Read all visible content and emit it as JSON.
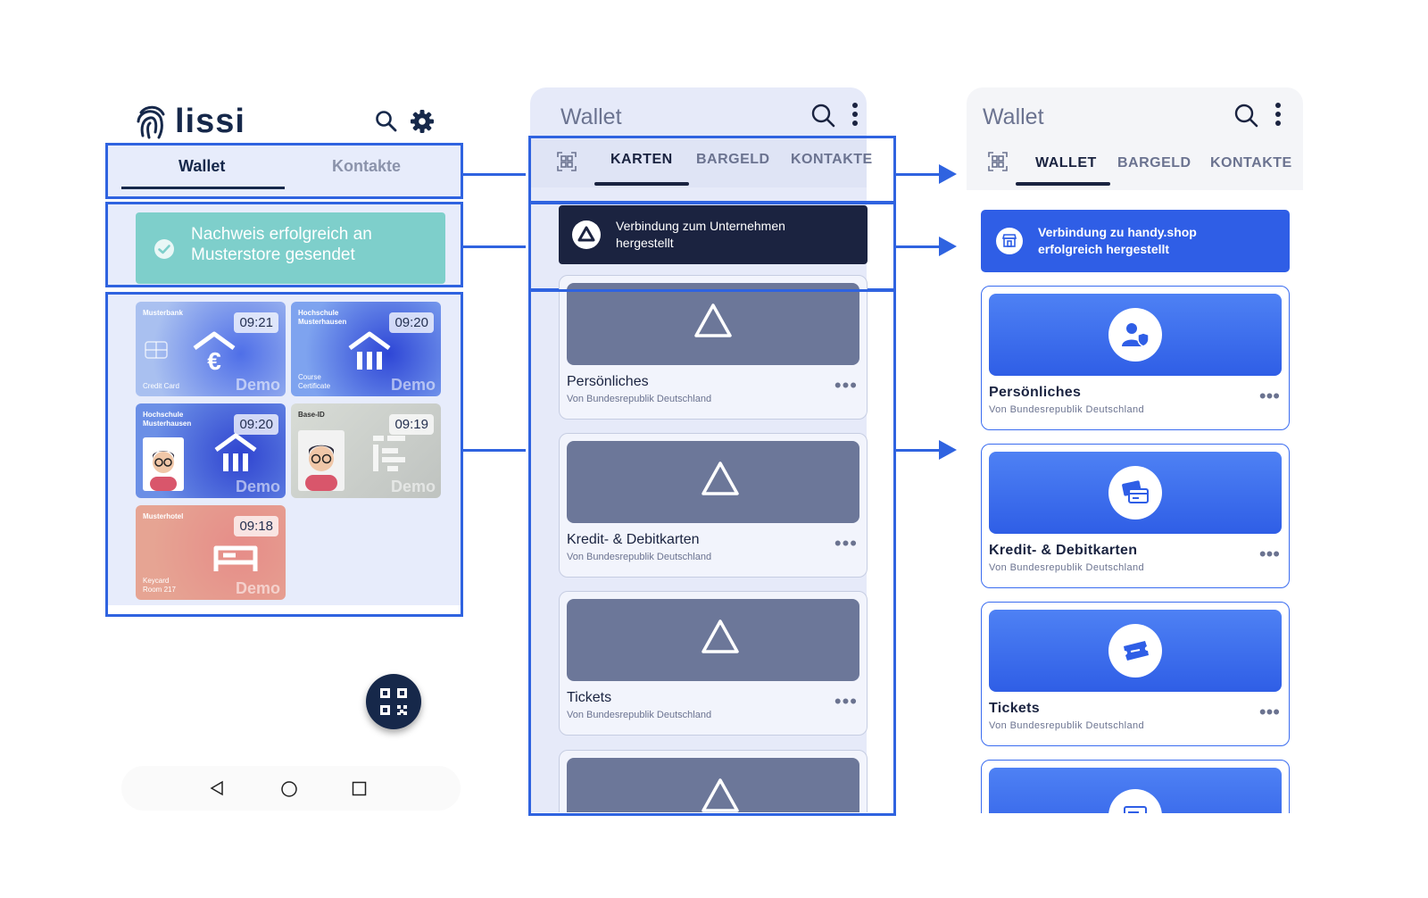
{
  "left": {
    "logo_text": "lissi",
    "tabs": [
      {
        "label": "Wallet"
      },
      {
        "label": "Kontakte"
      }
    ],
    "toast": "Nachweis erfolgreich an Musterstore gesendet",
    "toast_line1": "Nachweis erfolgreich an",
    "toast_line2": "Musterstore gesendet",
    "cards": [
      {
        "issuer": "Musterbank",
        "issuer2": "",
        "time": "09:21",
        "sub1": "Credit Card",
        "sub2": "",
        "demo": "Demo",
        "color": "#8fb0ea"
      },
      {
        "issuer": "Hochschule",
        "issuer2": "Musterhausen",
        "time": "09:20",
        "sub1": "Course",
        "sub2": "Certificate",
        "demo": "Demo",
        "color": "#6f93e8"
      },
      {
        "issuer": "Hochschule",
        "issuer2": "Musterhausen",
        "time": "09:20",
        "sub1": "",
        "sub2": "",
        "demo": "Demo",
        "color": "#5f82e0"
      },
      {
        "issuer": "Base-ID",
        "issuer2": "",
        "time": "09:19",
        "sub1": "",
        "sub2": "",
        "demo": "Demo",
        "color": "#c9cdc9"
      },
      {
        "issuer": "Musterhotel",
        "issuer2": "",
        "time": "09:18",
        "sub1": "Keycard",
        "sub2": "Room 217",
        "demo": "Demo",
        "color": "#e29a8f"
      }
    ]
  },
  "middle": {
    "title": "Wallet",
    "tabs": [
      {
        "label": "KARTEN"
      },
      {
        "label": "BARGELD"
      },
      {
        "label": "KONTAKTE"
      }
    ],
    "banner_line1": "Verbindung zum Unternehmen",
    "banner_line2": "hergestellt",
    "cards": [
      {
        "title": "Persönliches",
        "subtitle": "Von Bundesrepublik Deutschland"
      },
      {
        "title": "Kredit- & Debitkarten",
        "subtitle": "Von Bundesrepublik Deutschland"
      },
      {
        "title": "Tickets",
        "subtitle": "Von Bundesrepublik Deutschland"
      }
    ]
  },
  "right": {
    "title": "Wallet",
    "tabs": [
      {
        "label": "WALLET"
      },
      {
        "label": "BARGELD"
      },
      {
        "label": "KONTAKTE"
      }
    ],
    "banner_line1": "Verbindung zu handy.shop",
    "banner_line2": "erfolgreich hergestellt",
    "cards": [
      {
        "title": "Persönliches",
        "subtitle": "Von Bundesrepublik Deutschland",
        "icon": "person-shield-icon"
      },
      {
        "title": "Kredit- & Debitkarten",
        "subtitle": "Von Bundesrepublik Deutschland",
        "icon": "credit-card-icon"
      },
      {
        "title": "Tickets",
        "subtitle": "Von Bundesrepublik Deutschland",
        "icon": "ticket-icon"
      }
    ]
  },
  "colors": {
    "accent": "#2f63e0",
    "navy": "#16284a",
    "toast": "#7ecfcb",
    "banner_dark": "#1b2340",
    "banner_blue": "#2f5ee6"
  }
}
